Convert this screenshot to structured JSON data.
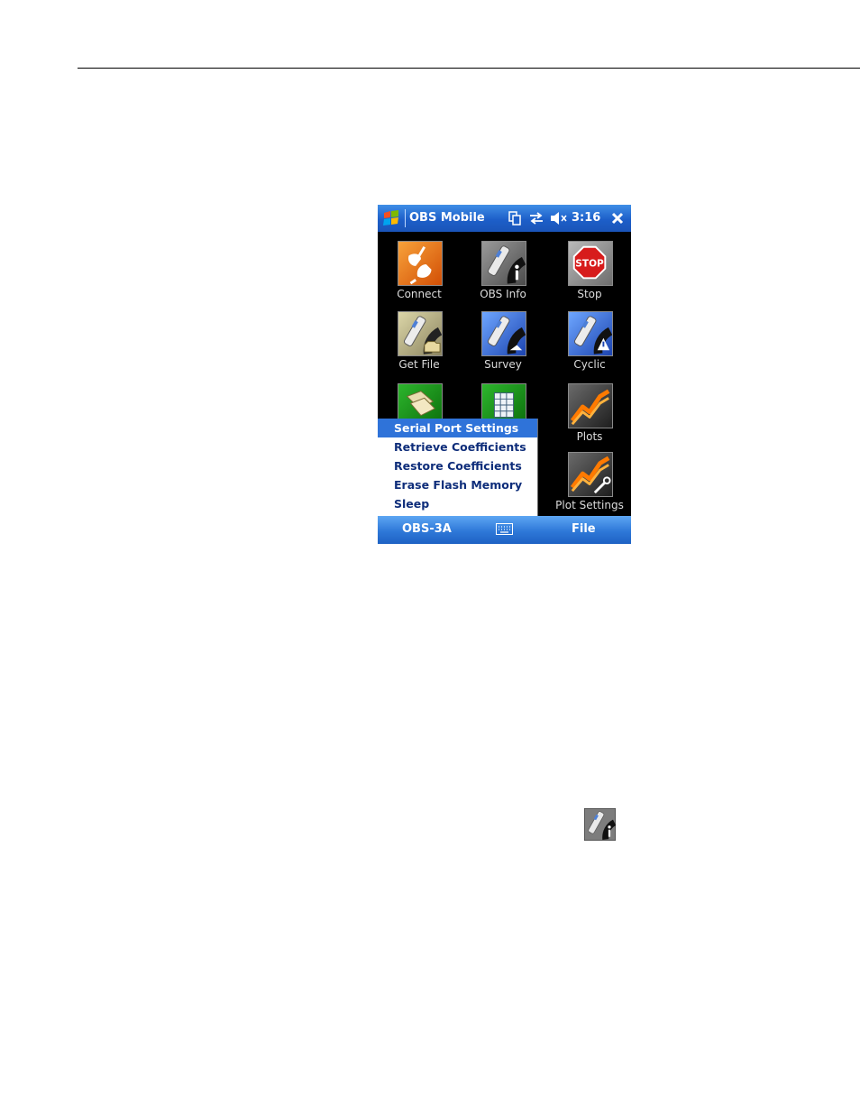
{
  "titlebar": {
    "app_title": "OBS Mobile",
    "time": "3:16",
    "start_icon": "windows-flag-icon",
    "tray_icons": [
      "clipboard-icon",
      "connectivity-arrows-icon",
      "speaker-muted-icon"
    ],
    "close_icon": "close-icon"
  },
  "tiles": [
    {
      "label": "Connect",
      "icon": "connect-plug-icon"
    },
    {
      "label": "OBS Info",
      "icon": "obs-info-icon"
    },
    {
      "label": "Stop",
      "icon": "stop-sign-icon"
    },
    {
      "label": "Get File",
      "icon": "get-file-icon"
    },
    {
      "label": "Survey",
      "icon": "survey-icon"
    },
    {
      "label": "Cyclic",
      "icon": "cyclic-icon"
    },
    {
      "label": "",
      "icon": "files-icon"
    },
    {
      "label": "",
      "icon": "spreadsheet-icon"
    },
    {
      "label": "Plots",
      "icon": "plots-chart-icon"
    },
    {
      "label": "Plot Settings",
      "icon": "plot-settings-icon"
    }
  ],
  "menu": {
    "items": [
      "Serial Port Settings",
      "Retrieve Coefficients",
      "Restore Coefficients",
      "Erase Flash Memory",
      "Sleep"
    ],
    "selected_index": 0
  },
  "bottombar": {
    "left_softkey": "OBS-3A",
    "right_softkey": "File",
    "keyboard_icon": "keyboard-icon"
  },
  "colors": {
    "titlebar": "#1d5fc9",
    "menu_selected": "#2f73d9",
    "menu_text": "#0e2d7a",
    "background": "#000000"
  }
}
